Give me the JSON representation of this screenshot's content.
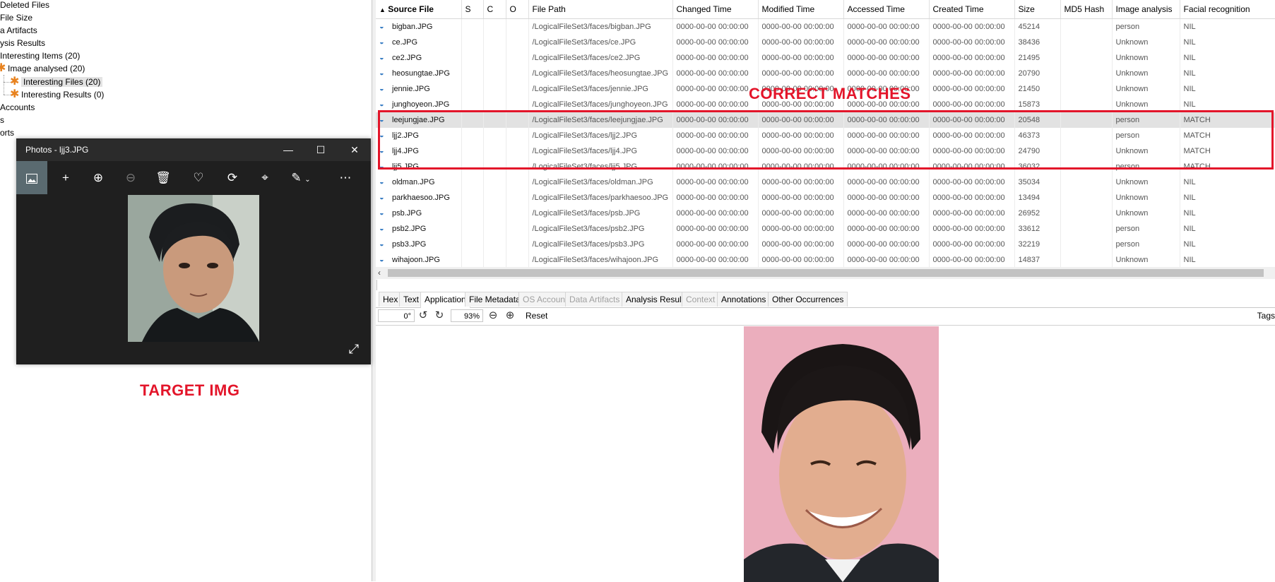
{
  "tree": {
    "items": [
      {
        "label": "Deleted Files"
      },
      {
        "label": "File Size"
      },
      {
        "label": "a Artifacts"
      },
      {
        "label": "ysis Results"
      },
      {
        "label": "Interesting Items (20)"
      },
      {
        "label": "Image analysed (20)"
      },
      {
        "label": "Interesting Files (20)"
      },
      {
        "label": "Interesting Results (0)"
      },
      {
        "label": "Accounts"
      },
      {
        "label": "s"
      },
      {
        "label": "orts"
      }
    ]
  },
  "photos": {
    "title": "Photos - ljj3.JPG",
    "toolbar": [
      "image-icon",
      "add-icon",
      "zoom-in-icon",
      "zoom-out-icon",
      "delete-icon",
      "favorite-icon",
      "rotate-icon",
      "crop-icon",
      "edit-icon",
      "more-icon"
    ]
  },
  "annotations": {
    "target": "TARGET IMG",
    "matches": "CORRECT MATCHES",
    "color": "#e3152a"
  },
  "table": {
    "columns": [
      "Source File",
      "S",
      "C",
      "O",
      "File Path",
      "Changed Time",
      "Modified Time",
      "Accessed Time",
      "Created Time",
      "Size",
      "MD5 Hash",
      "Image analysis",
      "Facial recognition"
    ],
    "rows": [
      [
        "bigban.JPG",
        "",
        "",
        "",
        "/LogicalFileSet3/faces/bigban.JPG",
        "0000-00-00 00:00:00",
        "0000-00-00 00:00:00",
        "0000-00-00 00:00:00",
        "0000-00-00 00:00:00",
        "45214",
        "",
        "person",
        "NIL"
      ],
      [
        "ce.JPG",
        "",
        "",
        "",
        "/LogicalFileSet3/faces/ce.JPG",
        "0000-00-00 00:00:00",
        "0000-00-00 00:00:00",
        "0000-00-00 00:00:00",
        "0000-00-00 00:00:00",
        "38436",
        "",
        "Unknown",
        "NIL"
      ],
      [
        "ce2.JPG",
        "",
        "",
        "",
        "/LogicalFileSet3/faces/ce2.JPG",
        "0000-00-00 00:00:00",
        "0000-00-00 00:00:00",
        "0000-00-00 00:00:00",
        "0000-00-00 00:00:00",
        "21495",
        "",
        "Unknown",
        "NIL"
      ],
      [
        "heosungtae.JPG",
        "",
        "",
        "",
        "/LogicalFileSet3/faces/heosungtae.JPG",
        "0000-00-00 00:00:00",
        "0000-00-00 00:00:00",
        "0000-00-00 00:00:00",
        "0000-00-00 00:00:00",
        "20790",
        "",
        "Unknown",
        "NIL"
      ],
      [
        "jennie.JPG",
        "",
        "",
        "",
        "/LogicalFileSet3/faces/jennie.JPG",
        "0000-00-00 00:00:00",
        "0000-00-00 00:00:00",
        "0000-00-00 00:00:00",
        "0000-00-00 00:00:00",
        "21450",
        "",
        "Unknown",
        "NIL"
      ],
      [
        "junghoyeon.JPG",
        "",
        "",
        "",
        "/LogicalFileSet3/faces/junghoyeon.JPG",
        "0000-00-00 00:00:00",
        "0000-00-00 00:00:00",
        "0000-00-00 00:00:00",
        "0000-00-00 00:00:00",
        "15873",
        "",
        "Unknown",
        "NIL"
      ],
      [
        "leejungjae.JPG",
        "",
        "",
        "",
        "/LogicalFileSet3/faces/leejungjae.JPG",
        "0000-00-00 00:00:00",
        "0000-00-00 00:00:00",
        "0000-00-00 00:00:00",
        "0000-00-00 00:00:00",
        "20548",
        "",
        "person",
        "MATCH"
      ],
      [
        "ljj2.JPG",
        "",
        "",
        "",
        "/LogicalFileSet3/faces/ljj2.JPG",
        "0000-00-00 00:00:00",
        "0000-00-00 00:00:00",
        "0000-00-00 00:00:00",
        "0000-00-00 00:00:00",
        "46373",
        "",
        "person",
        "MATCH"
      ],
      [
        "ljj4.JPG",
        "",
        "",
        "",
        "/LogicalFileSet3/faces/ljj4.JPG",
        "0000-00-00 00:00:00",
        "0000-00-00 00:00:00",
        "0000-00-00 00:00:00",
        "0000-00-00 00:00:00",
        "24790",
        "",
        "Unknown",
        "MATCH"
      ],
      [
        "ljj5.JPG",
        "",
        "",
        "",
        "/LogicalFileSet3/faces/ljj5.JPG",
        "0000-00-00 00:00:00",
        "0000-00-00 00:00:00",
        "0000-00-00 00:00:00",
        "0000-00-00 00:00:00",
        "36032",
        "",
        "person",
        "MATCH"
      ],
      [
        "oldman.JPG",
        "",
        "",
        "",
        "/LogicalFileSet3/faces/oldman.JPG",
        "0000-00-00 00:00:00",
        "0000-00-00 00:00:00",
        "0000-00-00 00:00:00",
        "0000-00-00 00:00:00",
        "35034",
        "",
        "Unknown",
        "NIL"
      ],
      [
        "parkhaesoo.JPG",
        "",
        "",
        "",
        "/LogicalFileSet3/faces/parkhaesoo.JPG",
        "0000-00-00 00:00:00",
        "0000-00-00 00:00:00",
        "0000-00-00 00:00:00",
        "0000-00-00 00:00:00",
        "13494",
        "",
        "Unknown",
        "NIL"
      ],
      [
        "psb.JPG",
        "",
        "",
        "",
        "/LogicalFileSet3/faces/psb.JPG",
        "0000-00-00 00:00:00",
        "0000-00-00 00:00:00",
        "0000-00-00 00:00:00",
        "0000-00-00 00:00:00",
        "26952",
        "",
        "Unknown",
        "NIL"
      ],
      [
        "psb2.JPG",
        "",
        "",
        "",
        "/LogicalFileSet3/faces/psb2.JPG",
        "0000-00-00 00:00:00",
        "0000-00-00 00:00:00",
        "0000-00-00 00:00:00",
        "0000-00-00 00:00:00",
        "33612",
        "",
        "person",
        "NIL"
      ],
      [
        "psb3.JPG",
        "",
        "",
        "",
        "/LogicalFileSet3/faces/psb3.JPG",
        "0000-00-00 00:00:00",
        "0000-00-00 00:00:00",
        "0000-00-00 00:00:00",
        "0000-00-00 00:00:00",
        "32219",
        "",
        "person",
        "NIL"
      ],
      [
        "wihajoon.JPG",
        "",
        "",
        "",
        "/LogicalFileSet3/faces/wihajoon.JPG",
        "0000-00-00 00:00:00",
        "0000-00-00 00:00:00",
        "0000-00-00 00:00:00",
        "0000-00-00 00:00:00",
        "14837",
        "",
        "Unknown",
        "NIL"
      ]
    ]
  },
  "viewer": {
    "tabs": [
      {
        "label": "Hex"
      },
      {
        "label": "Text"
      },
      {
        "label": "Application"
      },
      {
        "label": "File Metadata"
      },
      {
        "label": "OS Account"
      },
      {
        "label": "Data Artifacts"
      },
      {
        "label": "Analysis Results"
      },
      {
        "label": "Context"
      },
      {
        "label": "Annotations"
      },
      {
        "label": "Other Occurrences"
      }
    ],
    "rotation": "0°",
    "zoom": "93%",
    "reset_label": "Reset",
    "tags_label": "Tags"
  }
}
